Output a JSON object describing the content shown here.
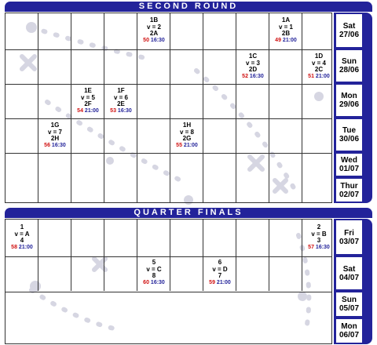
{
  "sections": {
    "second_round": "SECOND ROUND",
    "quarter_finals": "QUARTER FINALS"
  },
  "days": {
    "sat_2706": {
      "day": "Sat",
      "date": "27/06"
    },
    "sun_2806": {
      "day": "Sun",
      "date": "28/06"
    },
    "mon_2906": {
      "day": "Mon",
      "date": "29/06"
    },
    "tue_3006": {
      "day": "Tue",
      "date": "30/06"
    },
    "wed_0107": {
      "day": "Wed",
      "date": "01/07"
    },
    "thu_0207": {
      "day": "Thur",
      "date": "02/07"
    },
    "fri_0307": {
      "day": "Fri",
      "date": "03/07"
    },
    "sat_0407": {
      "day": "Sat",
      "date": "04/07"
    },
    "sun_0507": {
      "day": "Sun",
      "date": "05/07"
    },
    "mon_0607": {
      "day": "Mon",
      "date": "06/07"
    }
  },
  "matches": {
    "m49": {
      "home": "1A",
      "vs": "v = 1",
      "away": "2B",
      "num": "49",
      "time": "21:00"
    },
    "m50": {
      "home": "1B",
      "vs": "v = 2",
      "away": "2A",
      "num": "50",
      "time": "16:30"
    },
    "m51": {
      "home": "1D",
      "vs": "v = 4",
      "away": "2C",
      "num": "51",
      "time": "21:00"
    },
    "m52": {
      "home": "1C",
      "vs": "v = 3",
      "away": "2D",
      "num": "52",
      "time": "16:30"
    },
    "m53": {
      "home": "1F",
      "vs": "v = 6",
      "away": "2E",
      "num": "53",
      "time": "16:30"
    },
    "m54": {
      "home": "1E",
      "vs": "v = 5",
      "away": "2F",
      "num": "54",
      "time": "21:00"
    },
    "m55": {
      "home": "1H",
      "vs": "v = 8",
      "away": "2G",
      "num": "55",
      "time": "21:00"
    },
    "m56": {
      "home": "1G",
      "vs": "v = 7",
      "away": "2H",
      "num": "56",
      "time": "16:30"
    },
    "m57": {
      "home": "2",
      "vs": "v = B",
      "away": "3",
      "num": "57",
      "time": "16:30"
    },
    "m58": {
      "home": "1",
      "vs": "v = A",
      "away": "4",
      "num": "58",
      "time": "21:00"
    },
    "m59": {
      "home": "6",
      "vs": "v = D",
      "away": "7",
      "num": "59",
      "time": "21:00"
    },
    "m60": {
      "home": "5",
      "vs": "v = C",
      "away": "8",
      "num": "60",
      "time": "16:30"
    }
  },
  "colors": {
    "navy": "#23239a",
    "red": "#d01010"
  }
}
